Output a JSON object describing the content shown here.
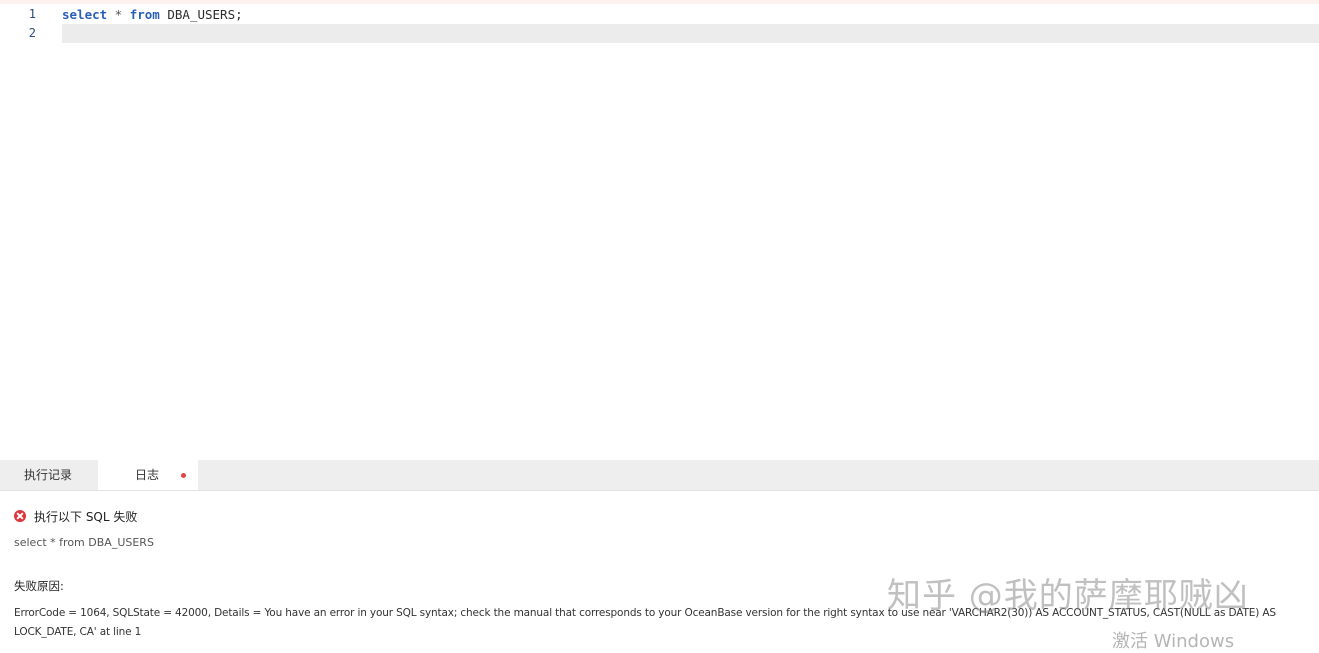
{
  "editor": {
    "line_numbers": [
      "1",
      "2"
    ],
    "code": {
      "kw_select": "select",
      "star": " * ",
      "kw_from": "from",
      "table": " DBA_USERS;"
    }
  },
  "tabs": {
    "history_label": "执行记录",
    "log_label": "日志"
  },
  "log": {
    "error_title": "执行以下 SQL 失败",
    "sql": "select * from DBA_USERS",
    "reason_label": "失败原因:",
    "reason_text": "ErrorCode = 1064, SQLState = 42000, Details = You have an error in your SQL syntax; check the manual that corresponds to your OceanBase version for the right syntax to use near 'VARCHAR2(30)) AS ACCOUNT_STATUS, CAST(NULL as DATE) AS LOCK_DATE, CA' at line 1"
  },
  "overlay": {
    "watermark": "知乎 @我的萨摩耶贼凶",
    "activate_windows": "激活 Windows"
  },
  "colors": {
    "keyword": "#2a5fb8",
    "line_number": "#2c4a7e",
    "error_red": "#e0343d",
    "unsaved_dot": "#e64545",
    "current_line": "#ececec",
    "tabbar_bg": "#eeeeee"
  },
  "icons": {
    "error": "error-circle-icon",
    "unsaved": "unsaved-dot-icon"
  }
}
